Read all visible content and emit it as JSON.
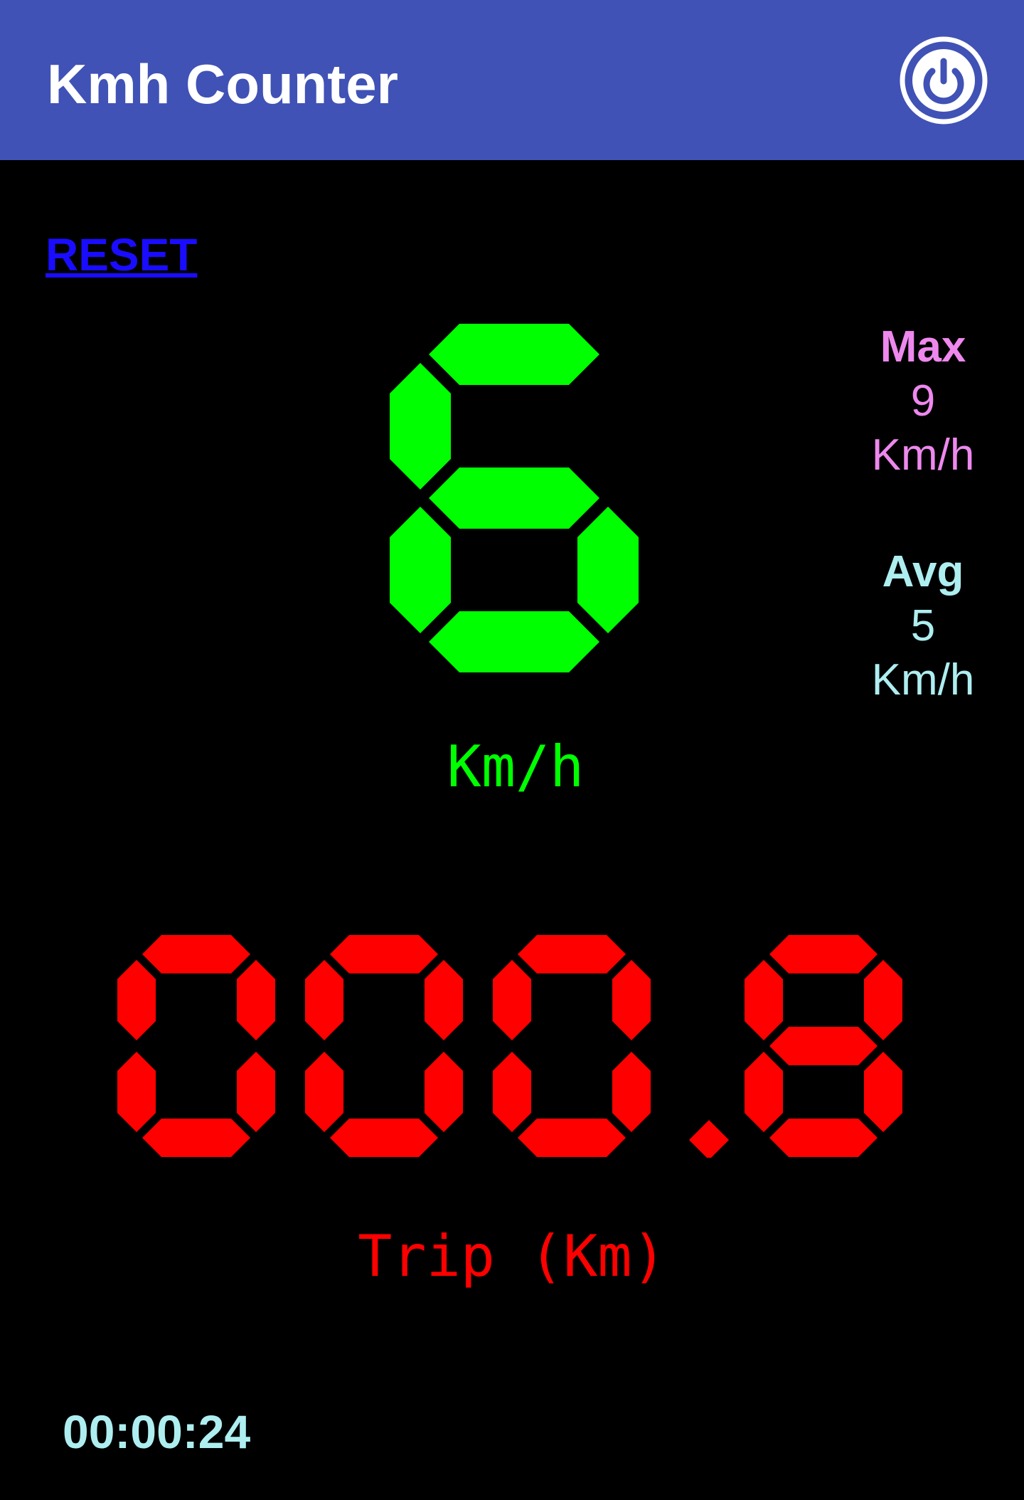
{
  "app": {
    "title": "Kmh Counter",
    "power_icon": "power-icon"
  },
  "controls": {
    "reset_label": "RESET"
  },
  "speed": {
    "value": "6",
    "unit": "Km/h",
    "color": "#00FF00"
  },
  "stats": {
    "max": {
      "label": "Max",
      "value": "9",
      "unit": "Km/h",
      "color": "#EE88EE"
    },
    "avg": {
      "label": "Avg",
      "value": "5",
      "unit": "Km/h",
      "color": "#AEEEF0"
    }
  },
  "trip": {
    "value": "000.8",
    "label": "Trip (Km)",
    "color": "#FF0000"
  },
  "timer": {
    "elapsed": "00:00:24"
  },
  "colors": {
    "appbar": "#4052B5",
    "background": "#000000",
    "link": "#1A0DFF"
  }
}
